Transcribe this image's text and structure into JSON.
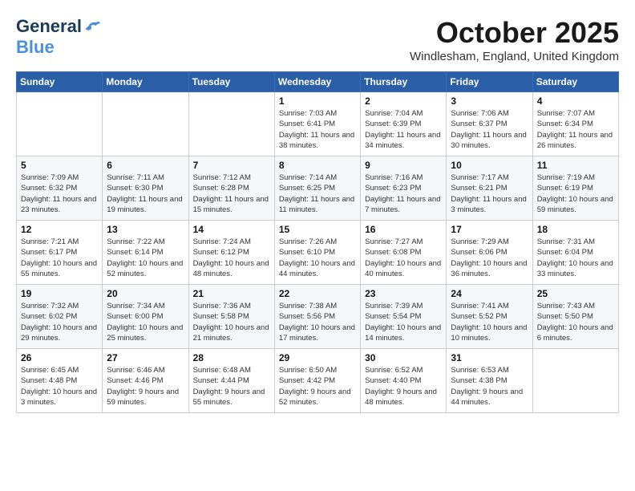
{
  "header": {
    "logo_line1": "General",
    "logo_line2": "Blue",
    "month_title": "October 2025",
    "location": "Windlesham, England, United Kingdom"
  },
  "weekdays": [
    "Sunday",
    "Monday",
    "Tuesday",
    "Wednesday",
    "Thursday",
    "Friday",
    "Saturday"
  ],
  "rows": [
    [
      {
        "day": "",
        "info": ""
      },
      {
        "day": "",
        "info": ""
      },
      {
        "day": "",
        "info": ""
      },
      {
        "day": "1",
        "info": "Sunrise: 7:03 AM\nSunset: 6:41 PM\nDaylight: 11 hours and 38 minutes."
      },
      {
        "day": "2",
        "info": "Sunrise: 7:04 AM\nSunset: 6:39 PM\nDaylight: 11 hours and 34 minutes."
      },
      {
        "day": "3",
        "info": "Sunrise: 7:06 AM\nSunset: 6:37 PM\nDaylight: 11 hours and 30 minutes."
      },
      {
        "day": "4",
        "info": "Sunrise: 7:07 AM\nSunset: 6:34 PM\nDaylight: 11 hours and 26 minutes."
      }
    ],
    [
      {
        "day": "5",
        "info": "Sunrise: 7:09 AM\nSunset: 6:32 PM\nDaylight: 11 hours and 23 minutes."
      },
      {
        "day": "6",
        "info": "Sunrise: 7:11 AM\nSunset: 6:30 PM\nDaylight: 11 hours and 19 minutes."
      },
      {
        "day": "7",
        "info": "Sunrise: 7:12 AM\nSunset: 6:28 PM\nDaylight: 11 hours and 15 minutes."
      },
      {
        "day": "8",
        "info": "Sunrise: 7:14 AM\nSunset: 6:25 PM\nDaylight: 11 hours and 11 minutes."
      },
      {
        "day": "9",
        "info": "Sunrise: 7:16 AM\nSunset: 6:23 PM\nDaylight: 11 hours and 7 minutes."
      },
      {
        "day": "10",
        "info": "Sunrise: 7:17 AM\nSunset: 6:21 PM\nDaylight: 11 hours and 3 minutes."
      },
      {
        "day": "11",
        "info": "Sunrise: 7:19 AM\nSunset: 6:19 PM\nDaylight: 10 hours and 59 minutes."
      }
    ],
    [
      {
        "day": "12",
        "info": "Sunrise: 7:21 AM\nSunset: 6:17 PM\nDaylight: 10 hours and 55 minutes."
      },
      {
        "day": "13",
        "info": "Sunrise: 7:22 AM\nSunset: 6:14 PM\nDaylight: 10 hours and 52 minutes."
      },
      {
        "day": "14",
        "info": "Sunrise: 7:24 AM\nSunset: 6:12 PM\nDaylight: 10 hours and 48 minutes."
      },
      {
        "day": "15",
        "info": "Sunrise: 7:26 AM\nSunset: 6:10 PM\nDaylight: 10 hours and 44 minutes."
      },
      {
        "day": "16",
        "info": "Sunrise: 7:27 AM\nSunset: 6:08 PM\nDaylight: 10 hours and 40 minutes."
      },
      {
        "day": "17",
        "info": "Sunrise: 7:29 AM\nSunset: 6:06 PM\nDaylight: 10 hours and 36 minutes."
      },
      {
        "day": "18",
        "info": "Sunrise: 7:31 AM\nSunset: 6:04 PM\nDaylight: 10 hours and 33 minutes."
      }
    ],
    [
      {
        "day": "19",
        "info": "Sunrise: 7:32 AM\nSunset: 6:02 PM\nDaylight: 10 hours and 29 minutes."
      },
      {
        "day": "20",
        "info": "Sunrise: 7:34 AM\nSunset: 6:00 PM\nDaylight: 10 hours and 25 minutes."
      },
      {
        "day": "21",
        "info": "Sunrise: 7:36 AM\nSunset: 5:58 PM\nDaylight: 10 hours and 21 minutes."
      },
      {
        "day": "22",
        "info": "Sunrise: 7:38 AM\nSunset: 5:56 PM\nDaylight: 10 hours and 17 minutes."
      },
      {
        "day": "23",
        "info": "Sunrise: 7:39 AM\nSunset: 5:54 PM\nDaylight: 10 hours and 14 minutes."
      },
      {
        "day": "24",
        "info": "Sunrise: 7:41 AM\nSunset: 5:52 PM\nDaylight: 10 hours and 10 minutes."
      },
      {
        "day": "25",
        "info": "Sunrise: 7:43 AM\nSunset: 5:50 PM\nDaylight: 10 hours and 6 minutes."
      }
    ],
    [
      {
        "day": "26",
        "info": "Sunrise: 6:45 AM\nSunset: 4:48 PM\nDaylight: 10 hours and 3 minutes."
      },
      {
        "day": "27",
        "info": "Sunrise: 6:46 AM\nSunset: 4:46 PM\nDaylight: 9 hours and 59 minutes."
      },
      {
        "day": "28",
        "info": "Sunrise: 6:48 AM\nSunset: 4:44 PM\nDaylight: 9 hours and 55 minutes."
      },
      {
        "day": "29",
        "info": "Sunrise: 6:50 AM\nSunset: 4:42 PM\nDaylight: 9 hours and 52 minutes."
      },
      {
        "day": "30",
        "info": "Sunrise: 6:52 AM\nSunset: 4:40 PM\nDaylight: 9 hours and 48 minutes."
      },
      {
        "day": "31",
        "info": "Sunrise: 6:53 AM\nSunset: 4:38 PM\nDaylight: 9 hours and 44 minutes."
      },
      {
        "day": "",
        "info": ""
      }
    ]
  ]
}
